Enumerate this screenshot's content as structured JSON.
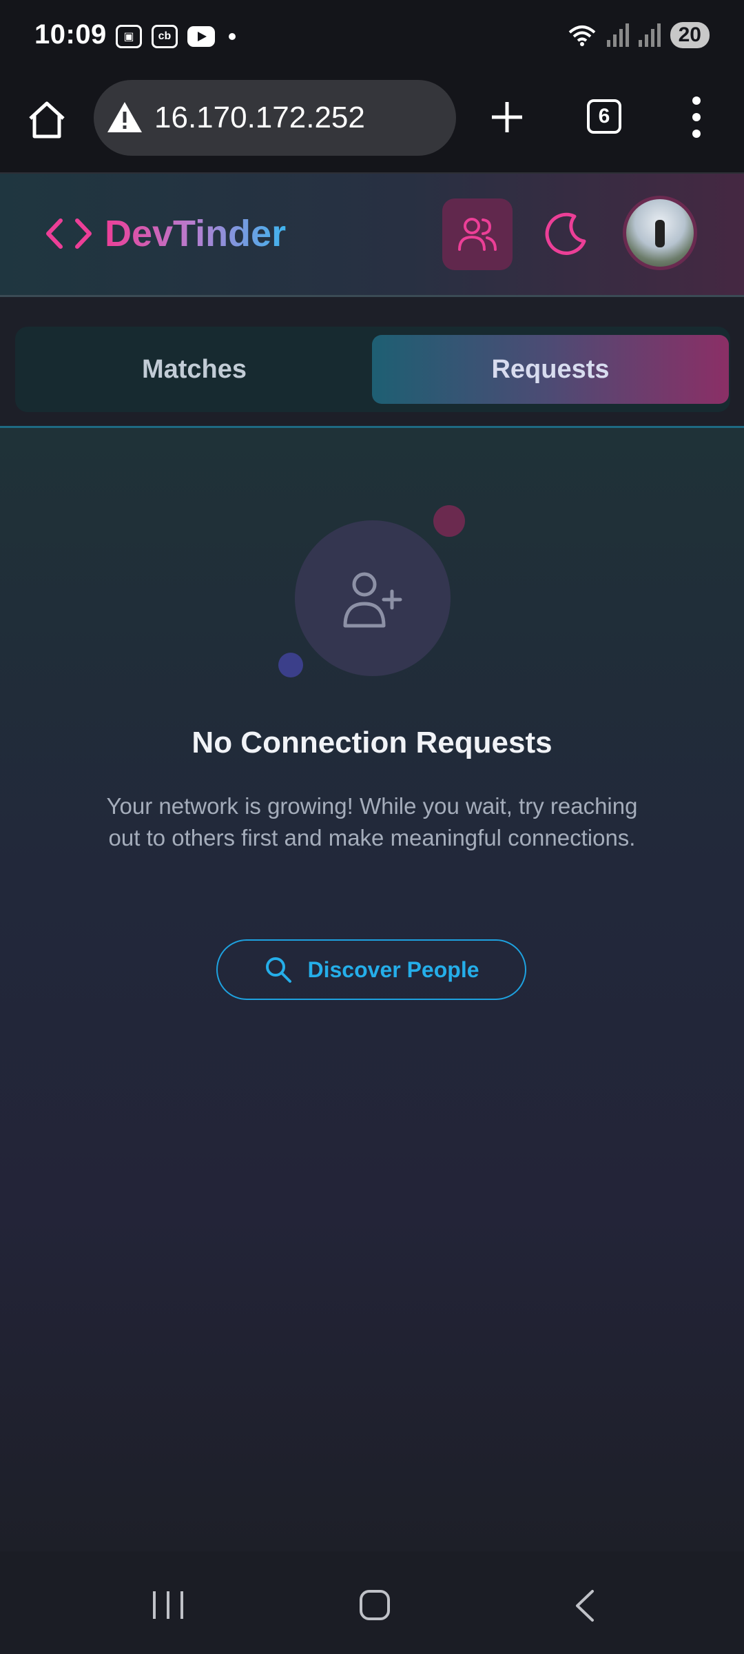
{
  "status_bar": {
    "time": "10:09",
    "battery": "20"
  },
  "browser": {
    "url": "16.170.172.252",
    "tab_count": "6"
  },
  "app": {
    "brand": "DevTinder",
    "tabs": [
      {
        "label": "Matches",
        "active": false
      },
      {
        "label": "Requests",
        "active": true
      }
    ]
  },
  "empty_state": {
    "title": "No Connection Requests",
    "description": "Your network is growing! While you wait, try reaching out to others first and make meaningful connections.",
    "button_label": "Discover People"
  },
  "colors": {
    "brand_pink": "#ec3f97",
    "accent_blue": "#25aee9",
    "background": "#1d1f28"
  },
  "icons": {
    "logo": "code-brackets-icon",
    "users": "users-icon",
    "theme": "moon-icon",
    "empty": "user-plus-icon",
    "search": "search-icon"
  }
}
